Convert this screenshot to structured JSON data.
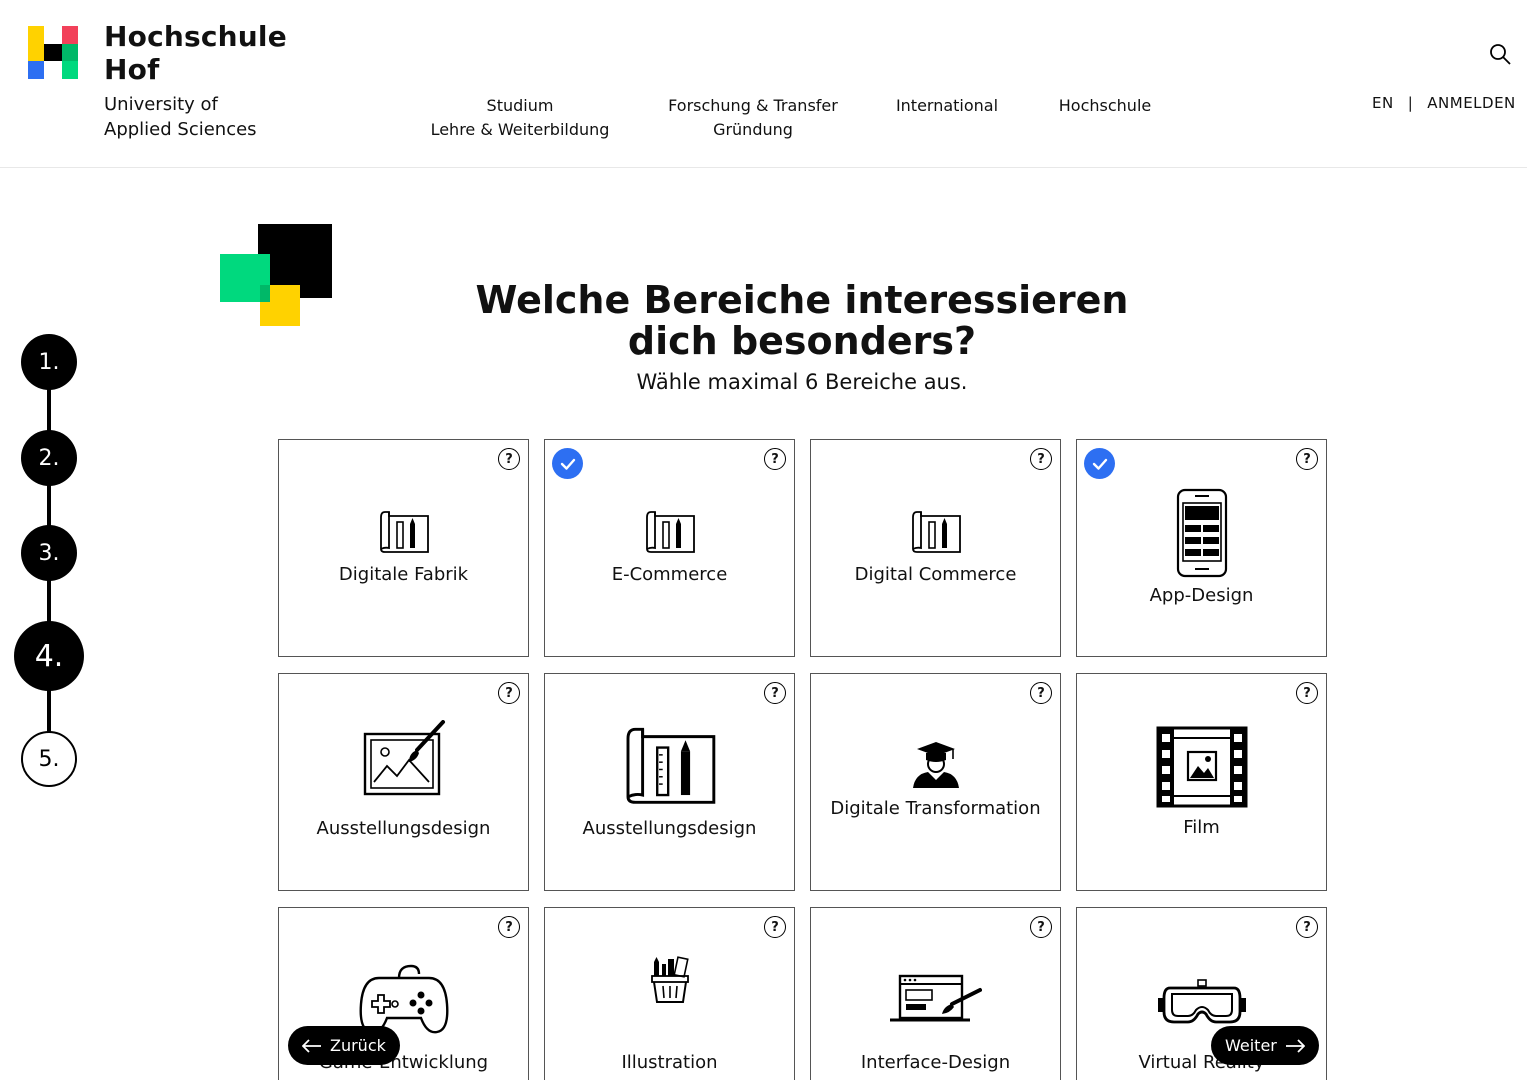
{
  "brand": {
    "title_line1": "Hochschule",
    "title_line2": "Hof",
    "sub_line1": "University of",
    "sub_line2": "Applied Sciences",
    "colors": {
      "yellow": "#FFD200",
      "red": "#F2415A",
      "green": "#00D97E",
      "blue": "#2D6FF2",
      "black": "#000000"
    }
  },
  "nav": [
    {
      "line1": "Studium",
      "line2": "Lehre & Weiterbildung"
    },
    {
      "line1": "Forschung & Transfer",
      "line2": "Gründung"
    },
    {
      "line1": "International",
      "line2": ""
    },
    {
      "line1": "Hochschule",
      "line2": ""
    }
  ],
  "utility": {
    "lang": "EN",
    "separator": "|",
    "login": "ANMELDEN",
    "search_icon": "search-icon"
  },
  "stepper": {
    "steps": [
      {
        "label": "1.",
        "state": "done"
      },
      {
        "label": "2.",
        "state": "done"
      },
      {
        "label": "3.",
        "state": "done"
      },
      {
        "label": "4.",
        "state": "current"
      },
      {
        "label": "5.",
        "state": "todo"
      }
    ]
  },
  "main": {
    "title_line1": "Welche Bereiche interessieren",
    "title_line2": "dich besonders?",
    "subtitle": "Wähle maximal 6 Bereiche aus.",
    "help_glyph": "?",
    "accent": "#2D6FF2"
  },
  "cards": [
    {
      "label": "Digitale Fabrik",
      "icon": "blueprint-icon",
      "selected": false
    },
    {
      "label": "E-Commerce",
      "icon": "blueprint-icon",
      "selected": true
    },
    {
      "label": "Digital Commerce",
      "icon": "blueprint-icon",
      "selected": false
    },
    {
      "label": "App-Design",
      "icon": "smartphone-icon",
      "selected": true
    },
    {
      "label": "Ausstellungsdesign",
      "icon": "painting-icon",
      "selected": false
    },
    {
      "label": "Ausstellungsdesign",
      "icon": "blueprint-icon",
      "selected": false
    },
    {
      "label": "Digitale Transformation",
      "icon": "graduate-icon",
      "selected": false
    },
    {
      "label": "Film",
      "icon": "film-icon",
      "selected": false
    },
    {
      "label": "Game-Entwicklung",
      "icon": "gamepad-icon",
      "selected": false
    },
    {
      "label": "Illustration",
      "icon": "pencil-cup-icon",
      "selected": false
    },
    {
      "label": "Interface-Design",
      "icon": "interface-design-icon",
      "selected": false
    },
    {
      "label": "Virtual Reality",
      "icon": "vr-headset-icon",
      "selected": false
    }
  ],
  "buttons": {
    "back": "Zurück",
    "next": "Weiter"
  }
}
